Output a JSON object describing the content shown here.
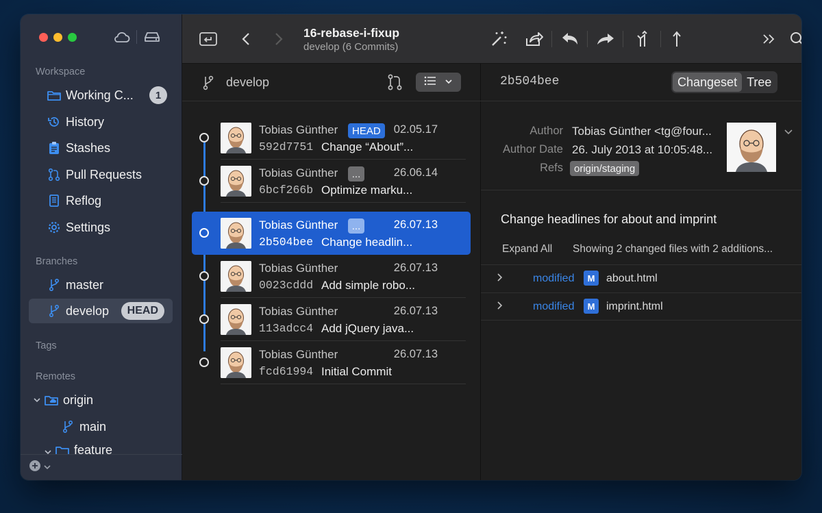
{
  "toolbar": {
    "title": "16-rebase-i-fixup",
    "subtitle": "develop (6 Commits)"
  },
  "sidebar": {
    "workspace_label": "Workspace",
    "working_copy_label": "Working C...",
    "working_copy_count": "1",
    "history_label": "History",
    "stashes_label": "Stashes",
    "pull_requests_label": "Pull Requests",
    "reflog_label": "Reflog",
    "settings_label": "Settings",
    "branches_label": "Branches",
    "branch_master": "master",
    "branch_develop": "develop",
    "head_badge": "HEAD",
    "tags_label": "Tags",
    "remotes_label": "Remotes",
    "remote_origin": "origin",
    "remote_branch_main": "main",
    "remote_folder_feature": "feature"
  },
  "list": {
    "branch_name": "develop",
    "commits": [
      {
        "author": "Tobias Günther",
        "tag": "HEAD",
        "date": "02.05.17",
        "hash": "592d7751",
        "message": "Change “About”..."
      },
      {
        "author": "Tobias Günther",
        "tag": "...",
        "date": "26.06.14",
        "hash": "6bcf266b",
        "message": "Optimize marku..."
      },
      {
        "author": "Tobias Günther",
        "tag": "...",
        "date": "26.07.13",
        "hash": "2b504bee",
        "message": "Change headlin..."
      },
      {
        "author": "Tobias Günther",
        "tag": "",
        "date": "26.07.13",
        "hash": "0023cddd",
        "message": "Add simple robo..."
      },
      {
        "author": "Tobias Günther",
        "tag": "",
        "date": "26.07.13",
        "hash": "113adcc4",
        "message": "Add jQuery java..."
      },
      {
        "author": "Tobias Günther",
        "tag": "",
        "date": "26.07.13",
        "hash": "fcd61994",
        "message": "Initial Commit"
      }
    ]
  },
  "detail": {
    "hash": "2b504bee",
    "seg_changeset": "Changeset",
    "seg_tree": "Tree",
    "author_label": "Author",
    "author_value": "Tobias Günther <tg@four...",
    "author_date_label": "Author Date",
    "author_date_value": "26. July 2013 at 10:05:48...",
    "refs_label": "Refs",
    "refs_value": "origin/staging",
    "subject": "Change headlines for about and imprint",
    "expand_all": "Expand All",
    "summary": "Showing 2 changed files with 2 additions...",
    "files": [
      {
        "status": "modified",
        "badge": "M",
        "name": "about.html"
      },
      {
        "status": "modified",
        "badge": "M",
        "name": "imprint.html"
      }
    ]
  },
  "colors": {
    "accent": "#2d7be0",
    "selection": "#1f5ecf",
    "sidebar_bg": "#2b3140"
  }
}
